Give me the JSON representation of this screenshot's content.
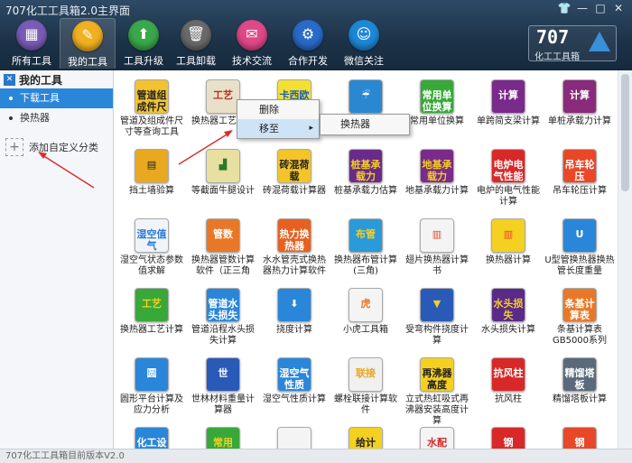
{
  "window": {
    "title": "707化工工具箱2.0主界面",
    "controls": [
      "👕",
      "—",
      "□",
      "✕"
    ]
  },
  "nav": [
    {
      "label": "所有工具",
      "icon": "toolbox-icon",
      "color": "#7a5cb8",
      "glyph": "▦"
    },
    {
      "label": "我的工具",
      "icon": "wrench-icon",
      "color": "#f0b020",
      "glyph": "✎"
    },
    {
      "label": "工具升级",
      "icon": "upgrade-icon",
      "color": "#3aa84a",
      "glyph": "⬆"
    },
    {
      "label": "工具卸载",
      "icon": "trash-icon",
      "color": "#6a6a6a",
      "glyph": "🗑"
    },
    {
      "label": "技术交流",
      "icon": "chat-icon",
      "color": "#e04888",
      "glyph": "✉"
    },
    {
      "label": "合作开发",
      "icon": "handshake-icon",
      "color": "#2a6ac8",
      "glyph": "⚙"
    },
    {
      "label": "微信关注",
      "icon": "wechat-icon",
      "color": "#1e88d8",
      "glyph": "☺"
    }
  ],
  "brand": {
    "number": "707",
    "subtitle": "化工工具箱"
  },
  "sidebar": {
    "header": "我的工具",
    "items": [
      {
        "label": "下载工具",
        "active": true
      },
      {
        "label": "换热器",
        "active": false
      }
    ],
    "add_label": "添加自定义分类"
  },
  "tools": [
    {
      "label": "管道及组成件尺寸等查询工具",
      "icon_text": "管道组成件尺寸",
      "bg": "#f2c230",
      "fg": "#222"
    },
    {
      "label": "换热器工艺计算",
      "icon_text": "工艺",
      "bg": "#e8e0c8",
      "fg": "#b83020"
    },
    {
      "label": "卡西欧",
      "icon_text": "卡西欧",
      "bg": "#f4e030",
      "fg": "#2060b0"
    },
    {
      "label": "",
      "icon_text": "☔",
      "bg": "#2a88d0",
      "fg": "#fff"
    },
    {
      "label": "常用单位换算",
      "icon_text": "常用单位换算",
      "bg": "#38a838",
      "fg": "#fff"
    },
    {
      "label": "单跨简支梁计算",
      "icon_text": "计算",
      "bg": "#7a2a8a",
      "fg": "#fff"
    },
    {
      "label": "单桩承载力计算",
      "icon_text": "计算",
      "bg": "#8a2a7a",
      "fg": "#fff"
    },
    {
      "label": "挡土墙验算",
      "icon_text": "▤",
      "bg": "#e8a820",
      "fg": "#222"
    },
    {
      "label": "等截面牛腿设计",
      "icon_text": "▟",
      "bg": "#e8e0a0",
      "fg": "#2a7a2a"
    },
    {
      "label": "砖混荷载计算器",
      "icon_text": "砖混荷载",
      "bg": "#f4c428",
      "fg": "#222"
    },
    {
      "label": "桩基承载力估算",
      "icon_text": "桩基承载力",
      "bg": "#6a2a8a",
      "fg": "#f4d020"
    },
    {
      "label": "地基承载力计算",
      "icon_text": "地基承载力",
      "bg": "#7a2a8a",
      "fg": "#f4d020"
    },
    {
      "label": "电炉的电气性能计算",
      "icon_text": "电炉电气性能",
      "bg": "#d82828",
      "fg": "#fff"
    },
    {
      "label": "吊车轮压计算",
      "icon_text": "吊车轮压",
      "bg": "#e84828",
      "fg": "#fff"
    },
    {
      "label": "湿空气状态参数值求解",
      "icon_text": "湿空值气",
      "bg": "#f0f4f8",
      "fg": "#2a7ad8"
    },
    {
      "label": "换热器管数计算软件（正三角",
      "icon_text": "管数",
      "bg": "#e87828",
      "fg": "#fff"
    },
    {
      "label": "水水管壳式换热器热力计算软件",
      "icon_text": "热力换热器",
      "bg": "#e86020",
      "fg": "#fff"
    },
    {
      "label": "换热器布管计算(三角)",
      "icon_text": "布管",
      "bg": "#2a9ad8",
      "fg": "#f4d020"
    },
    {
      "label": "翅片换热器计算书",
      "icon_text": "▥",
      "bg": "#f4f4f4",
      "fg": "#e84828"
    },
    {
      "label": "换热器计算",
      "icon_text": "▥",
      "bg": "#f4d020",
      "fg": "#e84828"
    },
    {
      "label": "U型管换热器换热管长度重量",
      "icon_text": "U",
      "bg": "#2a86d8",
      "fg": "#fff"
    },
    {
      "label": "换热器工艺计算",
      "icon_text": "工艺",
      "bg": "#38a838",
      "fg": "#f4d020"
    },
    {
      "label": "管道沿程水头损失计算",
      "icon_text": "管道水头损失",
      "bg": "#2a86d8",
      "fg": "#fff"
    },
    {
      "label": "挠度计算",
      "icon_text": "⬇",
      "bg": "#2a86d8",
      "fg": "#fff"
    },
    {
      "label": "小虎工具箱",
      "icon_text": "虎",
      "bg": "#f4f4f4",
      "fg": "#e87828"
    },
    {
      "label": "受弯构件挠度计算",
      "icon_text": "▼",
      "bg": "#2a5ab8",
      "fg": "#f4d020"
    },
    {
      "label": "水头损失计算",
      "icon_text": "水头损失",
      "bg": "#5a2a8a",
      "fg": "#f4d020"
    },
    {
      "label": "条基计算表GB5000系列",
      "icon_text": "条基计算表",
      "bg": "#e87828",
      "fg": "#fff"
    },
    {
      "label": "圆形平台计算及应力分析",
      "icon_text": "圆",
      "bg": "#2a86d8",
      "fg": "#fff"
    },
    {
      "label": "世林材料重量计算器",
      "icon_text": "世",
      "bg": "#2a5ab8",
      "fg": "#fff"
    },
    {
      "label": "湿空气性质计算",
      "icon_text": "湿空气性质",
      "bg": "#2a86d8",
      "fg": "#fff"
    },
    {
      "label": "螺栓联接计算软件",
      "icon_text": "联接",
      "bg": "#f0f0f0",
      "fg": "#e8a820"
    },
    {
      "label": "立式热虹吸式再沸器安装高度计算",
      "icon_text": "再沸器高度",
      "bg": "#f4d020",
      "fg": "#222"
    },
    {
      "label": "抗风柱",
      "icon_text": "抗风柱",
      "bg": "#d82828",
      "fg": "#fff"
    },
    {
      "label": "精馏塔板计算",
      "icon_text": "精馏塔板",
      "bg": "#5a6a7a",
      "fg": "#fff"
    },
    {
      "label": "",
      "icon_text": "化工设计",
      "bg": "#2a86d8",
      "fg": "#fff"
    },
    {
      "label": "",
      "icon_text": "常用",
      "bg": "#38a838",
      "fg": "#f4d020"
    },
    {
      "label": "",
      "icon_text": "",
      "bg": "#f4f4f4",
      "fg": "#222"
    },
    {
      "label": "",
      "icon_text": "给计",
      "bg": "#f4d020",
      "fg": "#222"
    },
    {
      "label": "",
      "icon_text": "水配",
      "bg": "#f4f4f4",
      "fg": "#d82828"
    },
    {
      "label": "",
      "icon_text": "钢",
      "bg": "#d82828",
      "fg": "#fff"
    },
    {
      "label": "",
      "icon_text": "钢",
      "bg": "#e84828",
      "fg": "#fff"
    }
  ],
  "context_menu": {
    "items": [
      {
        "label": "删除"
      },
      {
        "label": "移至",
        "arrow": "▸"
      }
    ],
    "submenu": [
      {
        "label": "换热器"
      }
    ]
  },
  "status": "707化工工具箱目前版本V2.0"
}
